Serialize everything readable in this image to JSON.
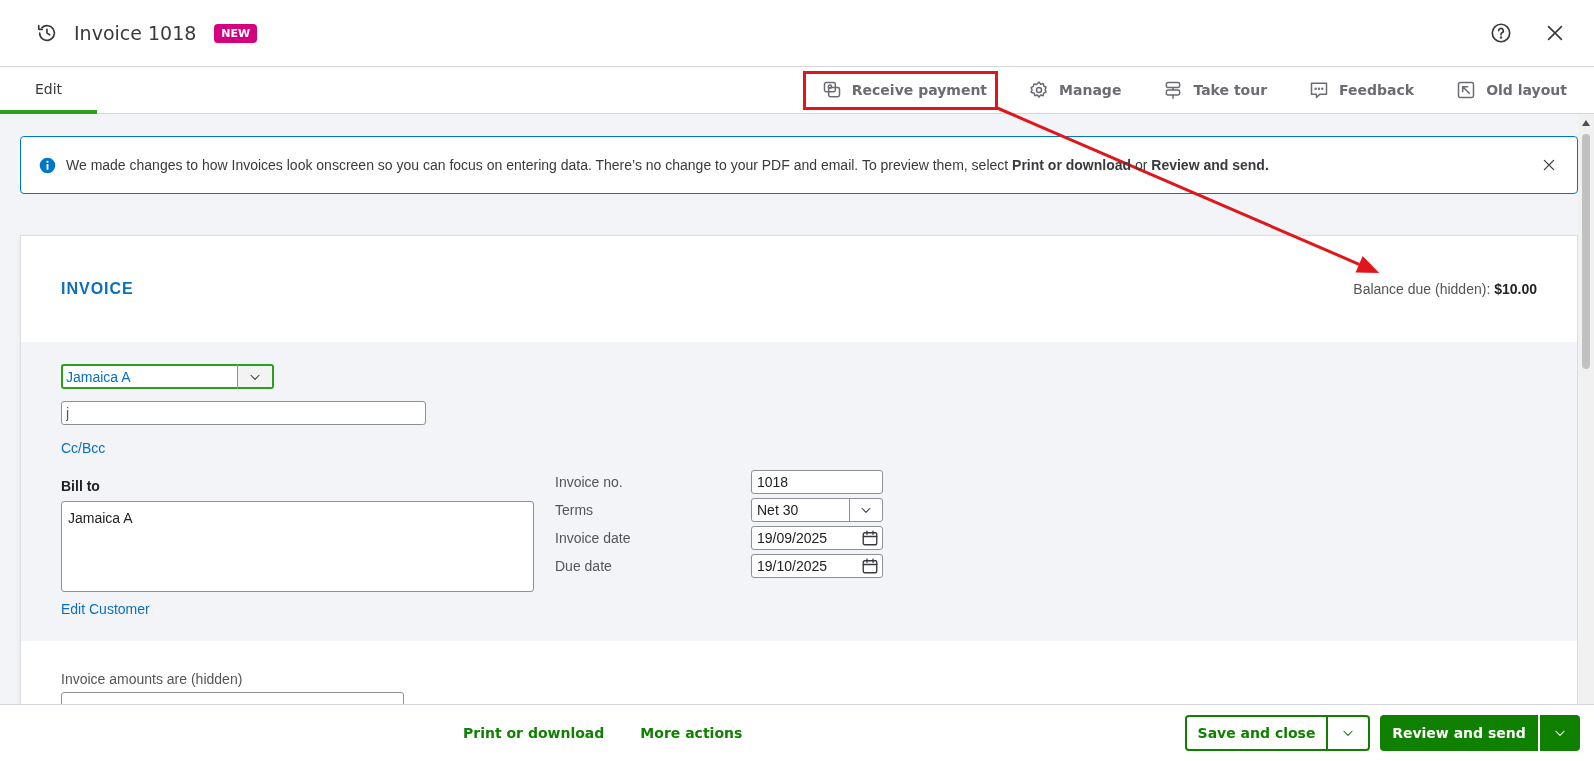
{
  "header": {
    "title": "Invoice 1018",
    "badge": "NEW"
  },
  "tabs": [
    {
      "label": "Edit",
      "selected": true
    }
  ],
  "toolbar": [
    {
      "label": "Receive payment",
      "kind": "payment",
      "highlighted": true
    },
    {
      "label": "Manage",
      "kind": "gear",
      "highlighted": false
    },
    {
      "label": "Take tour",
      "kind": "signpost",
      "highlighted": false
    },
    {
      "label": "Feedback",
      "kind": "chat",
      "highlighted": false
    },
    {
      "label": "Old layout",
      "kind": "layout",
      "highlighted": false
    }
  ],
  "notice": {
    "text": "We made changes to how Invoices look onscreen so you can focus on entering data. There’s no change to your PDF and email. To preview them, select **Print or download** or **Review and send.**"
  },
  "invoice": {
    "heading": "INVOICE",
    "balance": "Balance due (hidden): **$10.00**",
    "customer": {
      "value": "Jamaica A"
    },
    "email": {
      "value": "j"
    },
    "cc_link": "Cc/Bcc",
    "bill_to": {
      "label": "Bill to",
      "value": "Jamaica A"
    },
    "edit_link": "Edit Customer",
    "details": [
      {
        "label": "Invoice no.",
        "value": "1018",
        "kind": "text"
      },
      {
        "label": "Terms",
        "value": "Net 30",
        "kind": "select"
      },
      {
        "label": "Invoice date",
        "value": "19/09/2025",
        "kind": "date"
      },
      {
        "label": "Due date",
        "value": "19/10/2025",
        "kind": "date"
      }
    ],
    "amounts_label": "Invoice amounts are (hidden)"
  },
  "footer": {
    "links": [
      "Print or download",
      "More actions"
    ],
    "buttons": [
      {
        "label": "Save and close",
        "kind": "secondary"
      },
      {
        "label": "Review and send",
        "kind": "primary"
      }
    ]
  }
}
